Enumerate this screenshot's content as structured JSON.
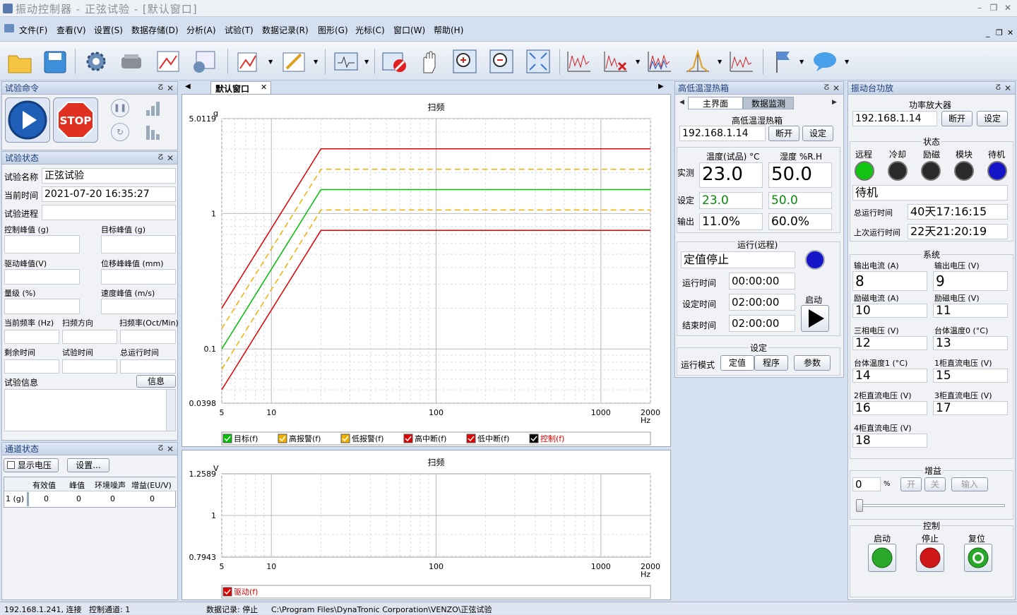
{
  "window": {
    "title": "振动控制器 - 正弦试验 - [默认窗口]"
  },
  "menu": [
    "文件(F)",
    "查看(V)",
    "设置(S)",
    "数据存储(D)",
    "分析(A)",
    "试验(T)",
    "数据记录(R)",
    "图形(G)",
    "光标(C)",
    "窗口(W)",
    "帮助(H)"
  ],
  "panels": {
    "cmd": "试验命令",
    "state": "试验状态",
    "channel": "通道状态",
    "chamber": "高低温湿热箱",
    "amp": "振动台功放"
  },
  "test_state": {
    "name_label": "试验名称",
    "name": "正弦试验",
    "time_label": "当前时间",
    "time": "2021-07-20 16:35:27",
    "progress_label": "试验进程",
    "ctrl_peak_label": "控制峰值 (g)",
    "target_peak_label": "目标峰值 (g)",
    "drive_peak_label": "驱动峰值(V)",
    "disp_peak_label": "位移峰峰值 (mm)",
    "level_label": "量级 (%)",
    "vel_peak_label": "速度峰值 (m/s)",
    "freq_label": "当前频率 (Hz)",
    "sweep_dir_label": "扫频方向",
    "sweep_rate_label": "扫频率(Oct/Min)",
    "remain_label": "剩余时间",
    "test_time_label": "试验时间",
    "total_time_label": "总运行时间",
    "info_label": "试验信息",
    "info_btn": "信息"
  },
  "channel_state": {
    "show_voltage": "显示电压",
    "settings_btn": "设置...",
    "columns": [
      "有效值",
      "峰值",
      "环境噪声",
      "增益(EU/V)"
    ],
    "rows": [
      {
        "name": "1 (g)",
        "values": [
          "0",
          "0",
          "0",
          "0"
        ]
      }
    ]
  },
  "tab": {
    "label": "默认窗口"
  },
  "chart_data": [
    {
      "type": "line",
      "title": "扫频",
      "ylabel": "g",
      "xlabel": "Hz",
      "x_log": true,
      "y_log": true,
      "xlim": [
        5,
        2000
      ],
      "ylim": [
        0.0398,
        5.0119
      ],
      "xticks": [
        "5",
        "10",
        "100",
        "1000",
        "2000"
      ],
      "yticks": [
        "5.0119",
        "1",
        "0.1",
        "0.0398"
      ],
      "series": [
        {
          "name": "目标(f)",
          "color": "#00c000",
          "x": [
            5,
            20,
            2000
          ],
          "y": [
            0.1,
            1.5,
            1.5
          ]
        },
        {
          "name": "高报警(f)",
          "color": "#f0b000",
          "dash": true,
          "x": [
            5,
            20,
            2000
          ],
          "y": [
            0.1413,
            2.1189,
            2.1189
          ]
        },
        {
          "name": "低报警(f)",
          "color": "#f0b000",
          "dash": true,
          "x": [
            5,
            20,
            2000
          ],
          "y": [
            0.0708,
            1.0616,
            1.0616
          ]
        },
        {
          "name": "高中断(f)",
          "color": "#e00000",
          "x": [
            5,
            20,
            2000
          ],
          "y": [
            0.2,
            3.0,
            3.0
          ]
        },
        {
          "name": "低中断(f)",
          "color": "#e00000",
          "x": [
            5,
            20,
            2000
          ],
          "y": [
            0.05,
            0.75,
            0.75
          ]
        }
      ],
      "legend_extra": {
        "name": "控制(f)",
        "color": "#e00000"
      }
    },
    {
      "type": "line",
      "title": "扫频",
      "ylabel": "V",
      "xlabel": "Hz",
      "x_log": true,
      "y_log": true,
      "xlim": [
        5,
        2000
      ],
      "ylim": [
        0.7943,
        1.2589
      ],
      "xticks": [
        "5",
        "10",
        "100",
        "1000",
        "2000"
      ],
      "yticks": [
        "1.2589",
        "1",
        "0.7943"
      ],
      "series": [],
      "legend_extra": {
        "name": "驱动(f)",
        "color": "#e00000"
      }
    }
  ],
  "chamber": {
    "tabs": [
      "主界面",
      "数据监测"
    ],
    "title": "高低温湿热箱",
    "ip": "192.168.1.14",
    "disconnect": "断开",
    "set": "设定",
    "temp_label": "温度(试品) °C",
    "hum_label": "湿度  %R.H",
    "row_actual": "实测",
    "row_set": "设定",
    "row_output": "输出",
    "temp_actual": "23.0",
    "hum_actual": "50.0",
    "temp_set": "23.0",
    "hum_set": "50.0",
    "temp_out": "11.0%",
    "hum_out": "60.0%",
    "run_title": "运行(远程)",
    "run_state": "定值停止",
    "run_time_label": "运行时间",
    "run_time": "00:00:00",
    "set_time_label": "设定时间",
    "set_time": "02:00:00",
    "end_time_label": "结束时间",
    "end_time": "02:00:00",
    "start_label": "启动",
    "setting_title": "设定",
    "mode_label": "运行模式",
    "mode_fixed": "定值",
    "mode_program": "程序",
    "params": "参数"
  },
  "amp": {
    "title": "功率放大器",
    "ip": "192.168.1.14",
    "disconnect": "断开",
    "set": "设定",
    "state_title": "状态",
    "lamps": [
      "远程",
      "冷却",
      "励磁",
      "模块",
      "待机"
    ],
    "lamp_colors": [
      "#12c412",
      "#2a2a2a",
      "#2a2a2a",
      "#2a2a2a",
      "#1414c8"
    ],
    "state_text": "待机",
    "total_run_label": "总运行时间",
    "total_run": "40天17:16:15",
    "last_run_label": "上次运行时间",
    "last_run": "22天21:20:19",
    "system_title": "系统",
    "sys": [
      {
        "label": "输出电流 (A)",
        "value": "8"
      },
      {
        "label": "输出电压 (V)",
        "value": "9"
      },
      {
        "label": "励磁电流 (A)",
        "value": "10"
      },
      {
        "label": "励磁电压 (V)",
        "value": "11"
      },
      {
        "label": "三相电压 (V)",
        "value": "12"
      },
      {
        "label": "台体温度0 (°C)",
        "value": "13"
      },
      {
        "label": "台体温度1 (°C)",
        "value": "14"
      },
      {
        "label": "1柜直流电压 (V)",
        "value": "15"
      },
      {
        "label": "2柜直流电压 (V)",
        "value": "16"
      },
      {
        "label": "3柜直流电压 (V)",
        "value": "17"
      },
      {
        "label": "4柜直流电压 (V)",
        "value": "18"
      }
    ],
    "gain_title": "增益",
    "gain": "0",
    "gain_unit": "%",
    "on": "开",
    "off": "关",
    "input": "输入",
    "slider": 0,
    "control_title": "控制",
    "start": "启动",
    "stop": "停止",
    "reset": "复位"
  },
  "status": {
    "conn": "192.168.1.241, 连接",
    "channel": "控制通道: 1",
    "record": "数据记录: 停止",
    "path": "C:\\Program Files\\DynaTronic Corporation\\VENZO\\正弦试验"
  }
}
